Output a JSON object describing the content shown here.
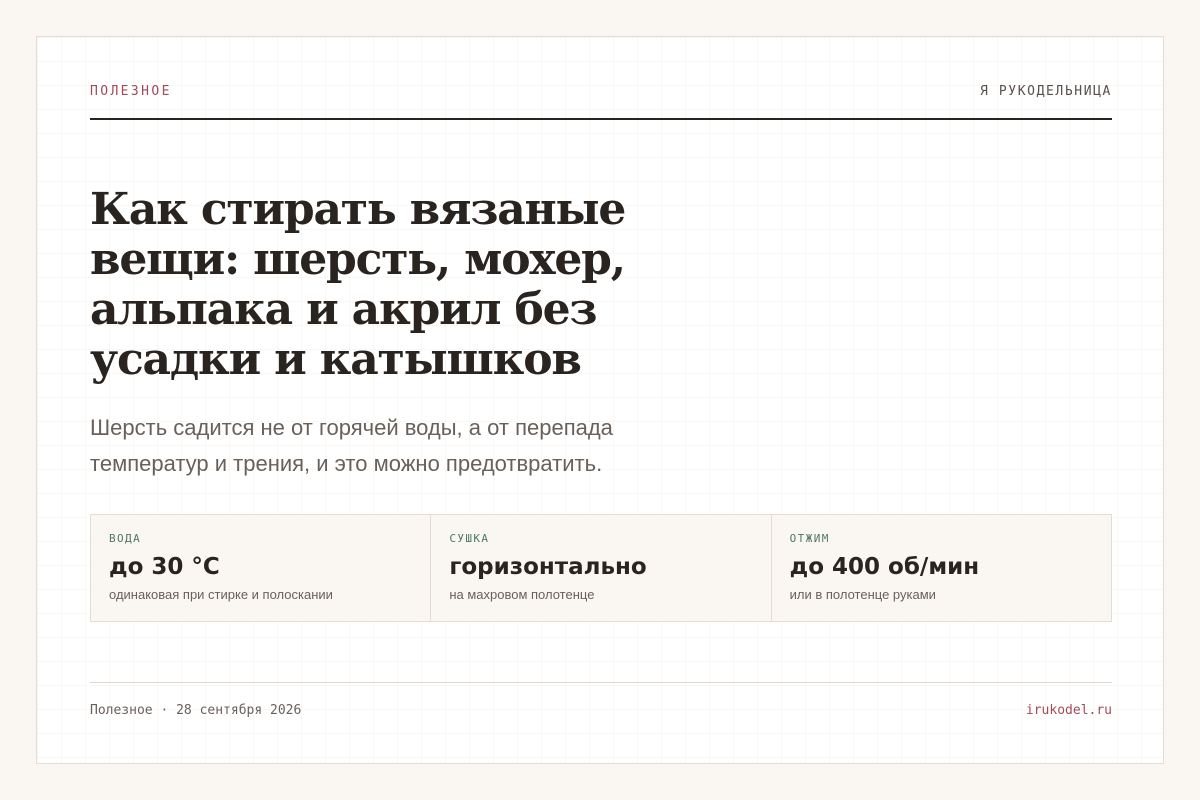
{
  "header": {
    "kicker": "ПОЛЕЗНОЕ",
    "brand": "Я РУКОДЕЛЬНИЦА"
  },
  "article": {
    "title": "Как стирать вязаные вещи: шерсть, мохер, альпака и акрил без усадки и катышков",
    "lead": "Шерсть садится не от горячей воды, а от перепада температур и трения, и это можно предотвратить."
  },
  "stats": [
    {
      "label": "ВОДА",
      "value": "до 30 °C",
      "note": "одинаковая при стирке и полоскании"
    },
    {
      "label": "СУШКА",
      "value": "горизонтально",
      "note": "на махровом полотенце"
    },
    {
      "label": "ОТЖИМ",
      "value": "до 400 об/мин",
      "note": "или в полотенце руками"
    }
  ],
  "footer": {
    "meta": "Полезное · 28 сентября 2026",
    "site": "irukodel.ru"
  },
  "colors": {
    "accent": "#a24a5a",
    "label_green": "#4e7a62",
    "text": "#2a2420",
    "muted": "#6a605a",
    "background": "#faf6f2"
  }
}
